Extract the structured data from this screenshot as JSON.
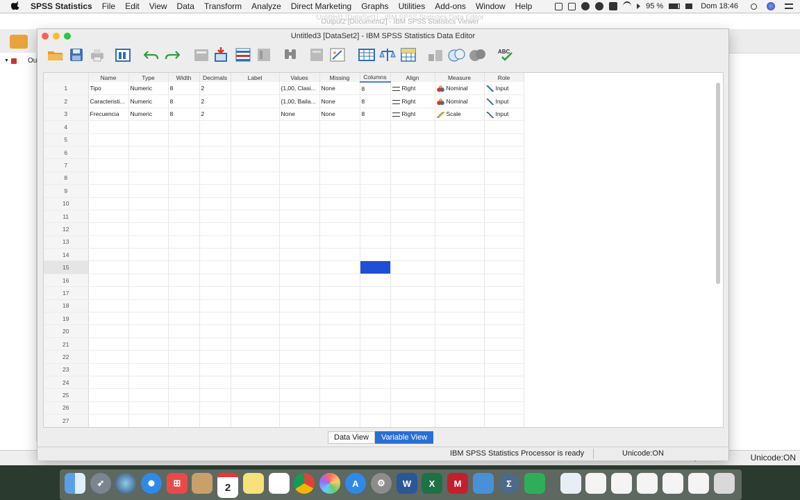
{
  "menubar": {
    "app_name": "SPSS Statistics",
    "items": [
      "File",
      "Edit",
      "View",
      "Data",
      "Transform",
      "Analyze",
      "Direct Marketing",
      "Graphs",
      "Utilities",
      "Add-ons",
      "Window",
      "Help"
    ],
    "battery": "95 %",
    "clock": "Dom 18:46"
  },
  "background": {
    "title_back": "Output2 [Document2] - IBM SPSS Statistics Viewer",
    "title_back2": "Untitled1 [DataSet1] - IBM SPSS Statistics Data Editor",
    "tree_label": "Out",
    "unicode": "Unicode:ON",
    "processor": "IBM SPSS Statistics Processor is ready"
  },
  "window": {
    "title": "Untitled3 [DataSet2] - IBM SPSS Statistics Data Editor"
  },
  "grid": {
    "headers": [
      "Name",
      "Type",
      "Width",
      "Decimals",
      "Label",
      "Values",
      "Missing",
      "Columns",
      "Align",
      "Measure",
      "Role"
    ],
    "rows": [
      {
        "n": "1",
        "name": "Tipo",
        "type": "Numeric",
        "width": "8",
        "decimals": "2",
        "label": "",
        "values": "{1,00, Clasi...",
        "missing": "None",
        "columns": "8",
        "align": "Right",
        "measure": "Nominal",
        "role": "Input"
      },
      {
        "n": "2",
        "name": "Caracteristi...",
        "type": "Numeric",
        "width": "8",
        "decimals": "2",
        "label": "",
        "values": "{1,00, Baila...",
        "missing": "None",
        "columns": "8",
        "align": "Right",
        "measure": "Nominal",
        "role": "Input"
      },
      {
        "n": "3",
        "name": "Frecuencia",
        "type": "Numeric",
        "width": "8",
        "decimals": "2",
        "label": "",
        "values": "None",
        "missing": "None",
        "columns": "8",
        "align": "Right",
        "measure": "Scale",
        "role": "Input"
      }
    ],
    "empty_rows": [
      "4",
      "5",
      "6",
      "7",
      "8",
      "9",
      "10",
      "11",
      "12",
      "13",
      "14",
      "15",
      "16",
      "17",
      "18",
      "19",
      "20",
      "21",
      "22",
      "23",
      "24",
      "25",
      "26",
      "27"
    ],
    "selected_row": "15"
  },
  "tabs": {
    "data_view": "Data View",
    "variable_view": "Variable View"
  },
  "status": {
    "processor": "IBM SPSS Statistics Processor is ready",
    "unicode": "Unicode:ON"
  },
  "dock": {
    "calendar_day": "2"
  },
  "colors": {
    "selection": "#1f4fd6",
    "tab_active": "#2a6fd6"
  }
}
